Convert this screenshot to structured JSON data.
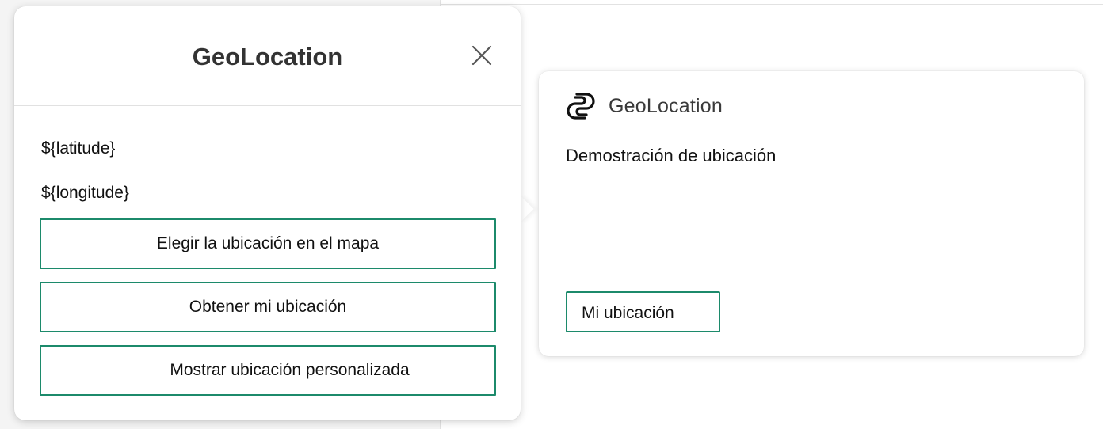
{
  "dialog": {
    "title": "GeoLocation",
    "close_icon": "close-icon",
    "latitude_text": "${latitude}",
    "longitude_text": "${longitude}",
    "buttons": [
      {
        "label": "Elegir la ubicación en el mapa"
      },
      {
        "label": "Obtener mi ubicación"
      },
      {
        "label": "Mostrar ubicación personalizada"
      }
    ]
  },
  "card": {
    "app_icon": "app-logo-icon",
    "app_name": "GeoLocation",
    "text": "Demostración de ubicación",
    "button_label": "Mi ubicación"
  },
  "colors": {
    "accent": "#1c8a6b",
    "text": "#111111",
    "title": "#333333",
    "background": "#ffffff"
  }
}
